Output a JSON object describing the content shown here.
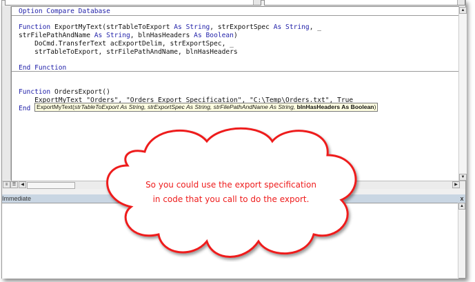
{
  "code_lines": [
    [
      "Option Compare Database"
    ],
    [],
    [
      "Function ExportMyText(strTableToExport As String, strExportSpec As String, _"
    ],
    [
      "strFilePathAndName As String, blnHasHeaders As Boolean)"
    ],
    [
      "    DoCmd.TransferText acExportDelim, strExportSpec, _"
    ],
    [
      "    strTableToExport, strFilePathAndName, blnHasHeaders"
    ],
    [],
    [
      "End Function"
    ]
  ],
  "code": {
    "l1_kw": "Option Compare Database",
    "l2_a": "Function",
    "l2_b": " ExportMyText(strTableToExport ",
    "as": "As",
    "string": "String",
    "l2_c": ", strExportSpec ",
    "l2_d": ", _",
    "l3_a": "strFilePathAndName ",
    "l3_b": ", blnHasHeaders ",
    "boolean": "Boolean",
    "l3_c": ")",
    "l4": "    DoCmd.TransferText acExportDelim, strExportSpec, _",
    "l5": "    strTableToExport, strFilePathAndName, blnHasHeaders",
    "l6": "End Function",
    "l7_b": " OrdersExport()",
    "l8": "    ExportMyText \"Orders\", \"Orders Export Specification\", \"C:\\Temp\\Orders.txt\", True",
    "l9": "End"
  },
  "tooltip": {
    "name": "ExportMyText(",
    "params": "strTableToExport As String, strExportSpec As String, strFilePathAndName As String, ",
    "current": "blnHasHeaders As Boolean",
    "close": ")"
  },
  "immediate": {
    "title": "Immediate",
    "close": "x"
  },
  "callout": {
    "line1": "So you could use the export specification",
    "line2": "in code that you call to do the export.",
    "color": "#ee1c1c"
  }
}
